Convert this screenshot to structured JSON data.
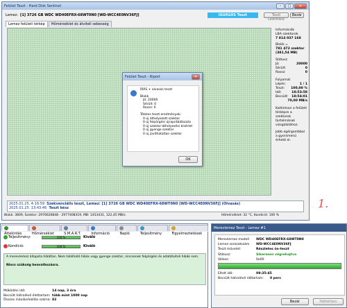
{
  "main_window": {
    "title": "Felület Teszt - Hard Disk Sentinel",
    "disk_label": "Lemez:",
    "disk_value": "[1] 3726 GB  WDC WD40EFRX-68WT0N0 [WD-WCC4E0NV36FJ]",
    "mode_badge": "OLVASÁS Teszt",
    "btn_stop": "Teszt Leállítása",
    "btn_close": "Bezár",
    "tabs": [
      "Lemez felületi térkép",
      "Hőmérséklet és átviteli sebesség"
    ],
    "info": {
      "heading": "Információk",
      "lba_label": "LBA szektorok",
      "lba_value": "7 814 037 168",
      "block_label": "Blokk =",
      "block_value": "781 472 szektor",
      "block_size": "(381,54 MB)",
      "status_heading": "Státusz",
      "status": [
        {
          "label": "Jó:",
          "value": "20000"
        },
        {
          "label": "Sérült:",
          "value": "0"
        },
        {
          "label": "Rossz:",
          "value": "0"
        }
      ],
      "progress_heading": "Folyamat",
      "progress": [
        {
          "label": "Lépés:",
          "value": "1 / 1"
        },
        {
          "label": "Teszt:",
          "value": "100,00 %"
        },
        {
          "label": "Idő:",
          "value": "18:53:58"
        },
        {
          "label": "Becsült:",
          "value": "18:54:01"
        },
        {
          "label": "",
          "value": "70,00 MB/s"
        }
      ],
      "hint1": "Kattintson a felületi térképre a szektorok tartalmának vizsgálatához.",
      "hint2": "Jobb egérgombbal a gyorsmenü érhető el."
    },
    "log": [
      {
        "time": "2025.01.25.  4:16:59",
        "text": "Szekvenciális teszt, Lemez: [1] 3726 GB  WDC WD40EFRX-68WT0N0 [WD-WCC4E0NV36FJ] (Olvasás)"
      },
      {
        "time": "2025.01.25.  13:43:46",
        "text": "Teszt kész"
      }
    ],
    "statusbar_left": "Blokk: 3809, Szektor: 2976626848 - 2977408319, MB: 1453431, 122,45 MB/s",
    "statusbar_right": "Hőmérséklet: 32 °C,  Kondíció: 100 %"
  },
  "dialog": {
    "title": "Felület Teszt - Riport",
    "line1": "ÍRÁS + olvasás teszt",
    "blocks_heading": "Blokk",
    "good": "Jó: 20000",
    "damaged": "Sérült: 0",
    "bad": "Rossz: 0",
    "results_heading": "Tételes teszt eredmények:",
    "results": [
      "0 új áthelyezett szektor",
      "0 új felpörgési újrapróbálkozás",
      "0 új szektor-áthelyezési kísérlet",
      "0 új gyenge szektor",
      "0 új javíthatatlan szektor"
    ],
    "ok": "OK"
  },
  "annotation": "1.",
  "bottom_left": {
    "tabs": [
      "Áttekintés",
      "Hőmérséklet",
      "S.M.A.R.T.",
      "Információ",
      "Napló",
      "Teljesítmény",
      "Figyelmeztetések"
    ],
    "perf_label": "Teljesítmény:",
    "perf_bar": "100 %",
    "perf_status": "Kiváló",
    "cond_label": "Kondíció:",
    "cond_bar": "100 %",
    "cond_status": "Kiváló",
    "message": "A merevlemez állapota hibátlan. Nem található hibás vagy gyenge szektor, nincsenek felpörgési és adatátviteli hibák sem.",
    "advice": "Nincs szükség beavatkozásra.",
    "stats": [
      {
        "label": "Működési idő:",
        "value": "14 nap, 3 óra"
      },
      {
        "label": "Becsült hátralévő élettartam:",
        "value": "több mint 1000 nap"
      },
      {
        "label": "Összes indulás/leállás száma:",
        "value": "82"
      }
    ]
  },
  "bottom_right": {
    "title": "Merevlemez Teszt - Lemez #1",
    "rows": [
      {
        "label": "Merevlemez modell",
        "value": "WDC WD40EFRX-68WT0N0"
      },
      {
        "label": "Lemez sorozatszám",
        "value": "WD-WCC4E0NV36FJ"
      },
      {
        "label": "Teszt művelet:",
        "value": "Részletes ön-teszt"
      },
      {
        "label": "Státusz:",
        "value": "Sikeresen végrehajtva"
      },
      {
        "label": "Válasz:",
        "value": "0x00"
      }
    ],
    "elapsed_label": "Eltelt idő:",
    "elapsed_value": "09:35:45",
    "remaining_label": "Becsült hátralévő időtartam:",
    "remaining_value": "0 perc",
    "btn_close": "Bezár",
    "btn_background": "Háttérben",
    "colors": {
      "success": "#1a8f1a",
      "accent": "#d9534f"
    }
  }
}
